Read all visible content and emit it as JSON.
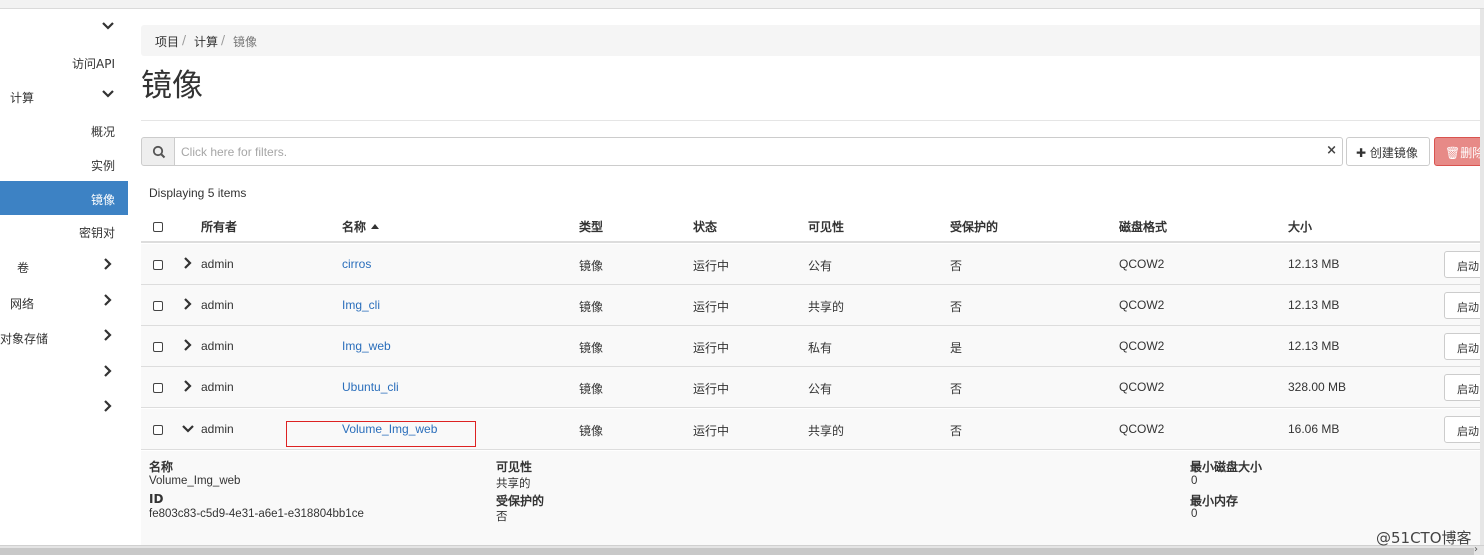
{
  "sidebar": {
    "items": [
      {
        "label": "",
        "chevron": "down"
      },
      {
        "label": "访问API",
        "chevron": ""
      },
      {
        "label": "计算",
        "chevron": "down"
      },
      {
        "label": "概况",
        "chevron": ""
      },
      {
        "label": "实例",
        "chevron": ""
      },
      {
        "label": "镜像",
        "chevron": "",
        "active": true
      },
      {
        "label": "密钥对",
        "chevron": ""
      },
      {
        "label": "卷",
        "chevron": "right"
      },
      {
        "label": "网络",
        "chevron": "right"
      },
      {
        "label": "对象存储",
        "chevron": "right"
      },
      {
        "label": "",
        "chevron": "right"
      },
      {
        "label": "",
        "chevron": "right"
      }
    ]
  },
  "breadcrumb": {
    "items": [
      "项目",
      "计算",
      "镜像"
    ],
    "separator": "/"
  },
  "page": {
    "title": "镜像"
  },
  "filter": {
    "placeholder": "Click here for filters.",
    "clear_icon": "×"
  },
  "actions": {
    "create_label": "创建镜像",
    "delete_label": "删除"
  },
  "table": {
    "summary": "Displaying 5 items",
    "headers": [
      "所有者",
      "名称",
      "类型",
      "状态",
      "可见性",
      "受保护的",
      "磁盘格式",
      "大小"
    ],
    "sorted_column": "名称",
    "launch_label": "启动",
    "rows": [
      {
        "owner": "admin",
        "name": "cirros",
        "type": "镜像",
        "status": "运行中",
        "visibility": "公有",
        "protected": "否",
        "format": "QCOW2",
        "size": "12.13 MB",
        "expanded": false
      },
      {
        "owner": "admin",
        "name": "Img_cli",
        "type": "镜像",
        "status": "运行中",
        "visibility": "共享的",
        "protected": "否",
        "format": "QCOW2",
        "size": "12.13 MB",
        "expanded": false
      },
      {
        "owner": "admin",
        "name": "Img_web",
        "type": "镜像",
        "status": "运行中",
        "visibility": "私有",
        "protected": "是",
        "format": "QCOW2",
        "size": "12.13 MB",
        "expanded": false
      },
      {
        "owner": "admin",
        "name": "Ubuntu_cli",
        "type": "镜像",
        "status": "运行中",
        "visibility": "公有",
        "protected": "否",
        "format": "QCOW2",
        "size": "328.00 MB",
        "expanded": false
      },
      {
        "owner": "admin",
        "name": "Volume_Img_web",
        "type": "镜像",
        "status": "运行中",
        "visibility": "共享的",
        "protected": "否",
        "format": "QCOW2",
        "size": "16.06 MB",
        "expanded": true
      }
    ]
  },
  "detail": {
    "name_label": "名称",
    "name_value": "Volume_Img_web",
    "id_label": "ID",
    "id_value": "fe803c83-c5d9-4e31-a6e1-e318804bb1ce",
    "visibility_label": "可见性",
    "visibility_value": "共享的",
    "protected_label": "受保护的",
    "protected_value": "否",
    "min_disk_label": "最小磁盘大小",
    "min_disk_value": "0",
    "min_ram_label": "最小内存",
    "min_ram_value": "0"
  },
  "watermark": "@51CTO博客",
  "colors": {
    "accent": "#3d82c4",
    "link": "#2a6ebb",
    "danger": "#e78a87",
    "highlight": "#dd2222"
  }
}
